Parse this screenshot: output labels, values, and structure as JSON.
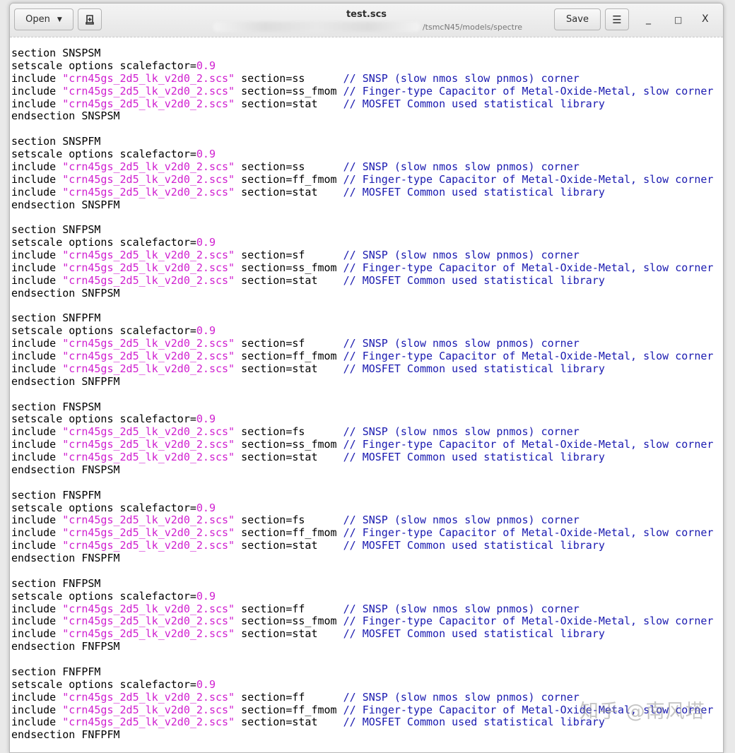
{
  "header": {
    "open_label": "Open",
    "title": "test.scs",
    "path": "/tsmcN45/models/spectre",
    "save_label": "Save",
    "minimize": "_",
    "maximize": "□",
    "close": "X"
  },
  "code": {
    "kw_section": "section",
    "kw_endsection": "endsection",
    "setscale": "setscale options scalefactor=",
    "scale_value": "0.9",
    "kw_include": "include",
    "lib": "\"crn45gs_2d5_lk_v2d0_2.scs\"",
    "comments": [
      "// SNSP (slow nmos slow pnmos) corner",
      "// Finger-type Capacitor of Metal-Oxide-Metal, slow corner",
      "// MOSFET Common used statistical library"
    ],
    "blocks": [
      {
        "name": "SNSPSM",
        "sections": [
          "section=ss",
          "section=ss_fmom",
          "section=stat"
        ]
      },
      {
        "name": "SNSPFM",
        "sections": [
          "section=ss",
          "section=ff_fmom",
          "section=stat"
        ]
      },
      {
        "name": "SNFPSM",
        "sections": [
          "section=sf",
          "section=ss_fmom",
          "section=stat"
        ]
      },
      {
        "name": "SNFPFM",
        "sections": [
          "section=sf",
          "section=ff_fmom",
          "section=stat"
        ]
      },
      {
        "name": "FNSPSM",
        "sections": [
          "section=fs",
          "section=ss_fmom",
          "section=stat"
        ]
      },
      {
        "name": "FNSPFM",
        "sections": [
          "section=fs",
          "section=ff_fmom",
          "section=stat"
        ]
      },
      {
        "name": "FNFPSM",
        "sections": [
          "section=ff",
          "section=ss_fmom",
          "section=stat"
        ]
      },
      {
        "name": "FNFPFM",
        "sections": [
          "section=ff",
          "section=ff_fmom",
          "section=stat"
        ]
      }
    ]
  },
  "watermark": "知乎 @南风塔"
}
